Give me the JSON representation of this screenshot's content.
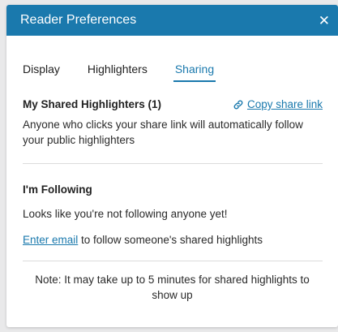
{
  "dialog": {
    "title": "Reader Preferences",
    "close_glyph": "✕"
  },
  "tabs": [
    {
      "label": "Display",
      "active": false
    },
    {
      "label": "Highlighters",
      "active": false
    },
    {
      "label": "Sharing",
      "active": true
    }
  ],
  "shared": {
    "heading": "My Shared Highlighters (1)",
    "copy_label": "Copy share link",
    "copy_icon": "link-icon",
    "description": "Anyone who clicks your share link will automatically follow your public highlighters"
  },
  "following": {
    "heading": "I'm Following",
    "empty_text": "Looks like you're not following anyone yet!",
    "enter_email_label": "Enter email",
    "enter_email_suffix": " to follow someone's shared highlights"
  },
  "note": "Note: It may take up to 5 minutes for shared highlights to show up",
  "colors": {
    "accent": "#1a79ad",
    "header_bg": "#1a79ad"
  }
}
